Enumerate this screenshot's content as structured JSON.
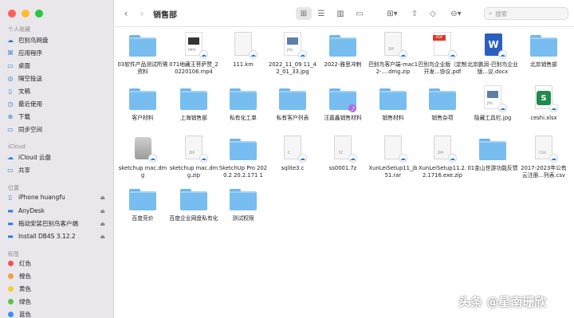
{
  "window": {
    "title": "销售部"
  },
  "toolbar": {
    "search_placeholder": "搜索"
  },
  "sidebar": {
    "sections": [
      {
        "label": "个人收藏",
        "items": [
          {
            "label": "巴别鸟网盘",
            "icon": "cloud-icon"
          },
          {
            "label": "应用程序",
            "icon": "apps-icon"
          },
          {
            "label": "桌面",
            "icon": "desktop-icon"
          },
          {
            "label": "隔空投送",
            "icon": "airdrop-icon"
          },
          {
            "label": "文稿",
            "icon": "document-icon"
          },
          {
            "label": "最近使用",
            "icon": "clock-icon"
          },
          {
            "label": "下载",
            "icon": "download-icon"
          },
          {
            "label": "同步空间",
            "icon": "folder-icon"
          }
        ]
      },
      {
        "label": "iCloud",
        "items": [
          {
            "label": "iCloud 云盘",
            "icon": "icloud-icon"
          },
          {
            "label": "共享",
            "icon": "shared-folder-icon"
          }
        ]
      },
      {
        "label": "位置",
        "items": [
          {
            "label": "iPhone huangfu",
            "icon": "phone-icon"
          },
          {
            "label": "AnyDesk",
            "icon": "disk-icon"
          },
          {
            "label": "拖动安装巴别鸟客户端",
            "icon": "disk-icon"
          },
          {
            "label": "Install DB4S 3.12.2",
            "icon": "disk-icon"
          }
        ]
      },
      {
        "label": "标签",
        "items": [
          {
            "label": "红色",
            "color": "#f0544c"
          },
          {
            "label": "橙色",
            "color": "#f5a03a"
          },
          {
            "label": "黄色",
            "color": "#f3cd3c"
          },
          {
            "label": "绿色",
            "color": "#58c24a"
          },
          {
            "label": "蓝色",
            "color": "#3d8df5"
          }
        ]
      }
    ]
  },
  "files": [
    {
      "name": "03软件产品测试所需资料",
      "kind": "folder"
    },
    {
      "name": "071地藏王菩萨赞_20220106.mp4",
      "kind": "video",
      "tag": "MP4"
    },
    {
      "name": "111.km",
      "kind": "doc"
    },
    {
      "name": "2022_11_09 11_42_01_33.jpg",
      "kind": "image",
      "tag": "JPG"
    },
    {
      "name": "2022-雅思冲刺",
      "kind": "folder"
    },
    {
      "name": "巴别鸟客户端-mac12-....dmg.zip",
      "kind": "doc",
      "tag": "ZIP"
    },
    {
      "name": "巴别鸟企业版（定制开发...协议.pdf",
      "kind": "pdf",
      "tag": "PDF"
    },
    {
      "name": "北京鹏润-巴别鸟企业版...议.docx",
      "kind": "word"
    },
    {
      "name": "北京销售部",
      "kind": "folder"
    },
    {
      "name": "客户材料",
      "kind": "folder"
    },
    {
      "name": "上海销售部",
      "kind": "folder"
    },
    {
      "name": "私有化工单",
      "kind": "folder"
    },
    {
      "name": "私有客户列表",
      "kind": "folder"
    },
    {
      "name": "汪嘉鑫销售材料",
      "kind": "folder-shared"
    },
    {
      "name": "销售材料",
      "kind": "folder"
    },
    {
      "name": "销售杂项",
      "kind": "folder"
    },
    {
      "name": "隐藏工具栏.jpg",
      "kind": "image",
      "tag": "JPG"
    },
    {
      "name": "ceshi.xlsx",
      "kind": "excel"
    },
    {
      "name": "sketchup mac.dmg",
      "kind": "app"
    },
    {
      "name": "sketchup mac.dmg.zip",
      "kind": "doc",
      "tag": "ZIP"
    },
    {
      "name": "SketchUp Pro 2020.2 20.2.171 1",
      "kind": "folder"
    },
    {
      "name": "sqlite3.c",
      "kind": "doc",
      "tag": "C"
    },
    {
      "name": "ss0001.7z",
      "kind": "doc",
      "tag": "7Z"
    },
    {
      "name": "XunLeiSetup11_jb51.rar",
      "kind": "doc"
    },
    {
      "name": "XunLeiSetup11.2.2.1716.exe.zip",
      "kind": "doc",
      "tag": "ZIP"
    },
    {
      "name": "01金山世游功能反馈",
      "kind": "folder"
    },
    {
      "name": "2017-2023年公有云注册...列表.csv",
      "kind": "doc",
      "tag": "CSV"
    },
    {
      "name": "百度竞价",
      "kind": "folder"
    },
    {
      "name": "百度企业网盘私有化",
      "kind": "folder"
    },
    {
      "name": "测试权限",
      "kind": "folder"
    }
  ],
  "watermark": "头条 @星南珊欣"
}
